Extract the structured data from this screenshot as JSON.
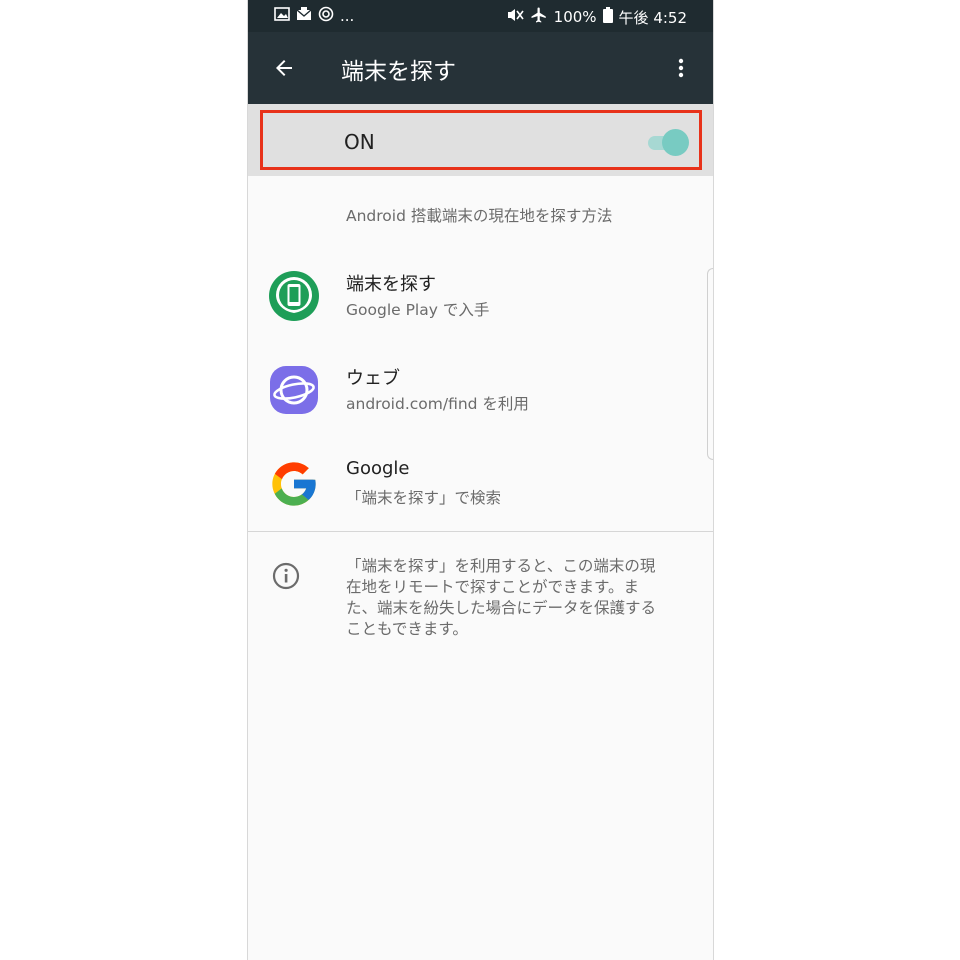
{
  "status_bar": {
    "left_extra": "...",
    "battery": "100%",
    "time": "午後 4:52"
  },
  "app_bar": {
    "title": "端末を探す"
  },
  "toggle": {
    "label": "ON",
    "state": "on",
    "accent_color": "#78cbc2",
    "highlight_color": "#e8321a"
  },
  "description": "Android 搭載端末の現在地を探す方法",
  "methods": [
    {
      "title": "端末を探す",
      "subtitle": "Google Play で入手",
      "icon": "find-device-icon"
    },
    {
      "title": "ウェブ",
      "subtitle": "android.com/find を利用",
      "icon": "internet-icon"
    },
    {
      "title": "Google",
      "subtitle": "「端末を探す」で検索",
      "icon": "google-icon"
    }
  ],
  "info": {
    "icon": "info-icon",
    "text": "「端末を探す」を利用すると、この端末の現\n在地をリモートで探すことができます。ま\nた、端末を紛失した場合にデータを保護する\nこともできます。"
  }
}
